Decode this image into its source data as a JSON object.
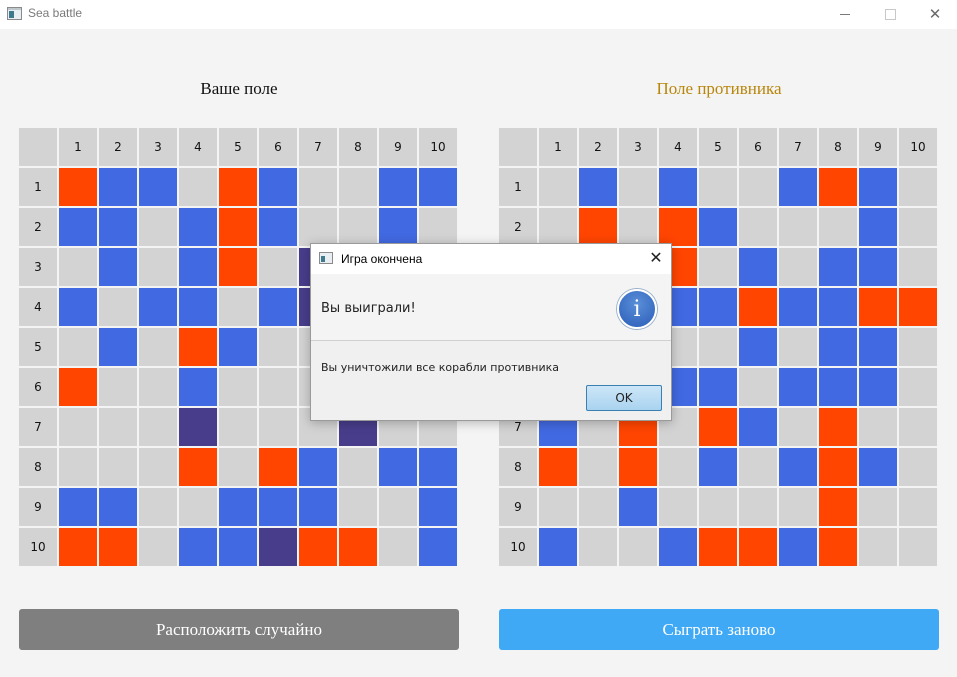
{
  "window": {
    "title": "Sea battle",
    "minimize_icon": "minimize-icon",
    "maximize_icon": "maximize-icon",
    "close_icon": "close-icon",
    "close_glyph": "✕"
  },
  "boards": {
    "own": {
      "title": "Ваше поле",
      "columns": [
        "1",
        "2",
        "3",
        "4",
        "5",
        "6",
        "7",
        "8",
        "9",
        "10"
      ],
      "rows": [
        "1",
        "2",
        "3",
        "4",
        "5",
        "6",
        "7",
        "8",
        "9",
        "10"
      ],
      "cells": [
        "HSSEHSEESS",
        "SSESHSEESE",
        "ESESHEDEEE",
        "SESSESDEEE",
        "ESEHSEEEEE",
        "HEESEEEEEE",
        "EEEDEEEDEE",
        "EEEHEHSESS",
        "SSEESSSEES",
        "HHESSDHHES"
      ]
    },
    "enemy": {
      "title": "Поле противника",
      "columns": [
        "1",
        "2",
        "3",
        "4",
        "5",
        "6",
        "7",
        "8",
        "9",
        "10"
      ],
      "rows": [
        "1",
        "2",
        "3",
        "4",
        "5",
        "6",
        "7",
        "8",
        "9",
        "10"
      ],
      "cells": [
        "ESESEESHSE",
        "EHEHSEEESE",
        "EEEHESESSE",
        "EEESSHSSHH",
        "EEEEESESSE",
        "EEESSESSSE",
        "SEHEHSEHEE",
        "HEHESESHSE",
        "EESEEEEHEE",
        "SEESHHSHEE"
      ]
    },
    "legend": {
      "E": "empty",
      "S": "ship",
      "H": "hit",
      "D": "destroyed"
    },
    "colors": {
      "empty": "#d3d3d3",
      "ship": "#4169e1",
      "hit": "#ff4500",
      "destroyed": "#483d8b"
    }
  },
  "buttons": {
    "random": "Расположить случайно",
    "restart": "Сыграть заново"
  },
  "dialog": {
    "title": "Игра окончена",
    "header": "Вы выиграли!",
    "body": "Вы уничтожили все корабли противника",
    "ok": "OK",
    "icon": "info-icon",
    "icon_glyph": "i",
    "close_glyph": "✕"
  }
}
